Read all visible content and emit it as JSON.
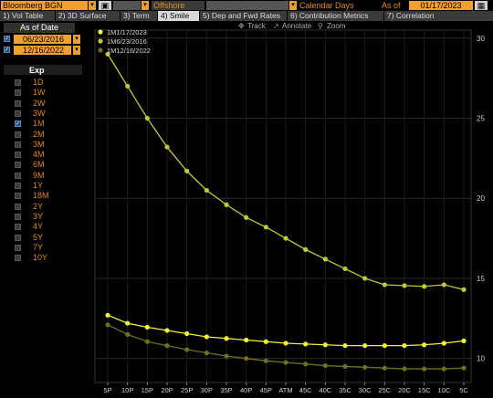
{
  "topbar": {
    "source": "Bloomberg BGN",
    "field2": "",
    "field3": "",
    "location": "Offshore",
    "field5": "",
    "days_mode": "Calendar Days",
    "asof_label": "As of",
    "asof_date": "01/17/2023"
  },
  "tabs": [
    {
      "label": "1) Vol Table"
    },
    {
      "label": "2) 3D Surface"
    },
    {
      "label": "3) Term"
    },
    {
      "label": "4) Smile"
    },
    {
      "label": "5) Dep and Fwd Rates"
    },
    {
      "label": "6) Contribution Metrics"
    },
    {
      "label": "7) Correlation"
    }
  ],
  "sidebar": {
    "header": "As of Date",
    "dates": [
      "06/23/2016",
      "12/16/2022"
    ],
    "exp_header": "Exp",
    "expiries": [
      "1D",
      "1W",
      "2W",
      "3W",
      "1M",
      "2M",
      "3M",
      "4M",
      "6M",
      "9M",
      "1Y",
      "18M",
      "2Y",
      "3Y",
      "4Y",
      "5Y",
      "7Y",
      "10Y"
    ],
    "checked_expiry": "1M"
  },
  "toolbar": {
    "track": "Track",
    "annotate": "Annotate",
    "zoom": "Zoom"
  },
  "chart_data": {
    "type": "line",
    "categories": [
      "5P",
      "10P",
      "15P",
      "20P",
      "25P",
      "30P",
      "35P",
      "40P",
      "45P",
      "ATM",
      "45C",
      "40C",
      "35C",
      "30C",
      "25C",
      "20C",
      "15C",
      "10C",
      "5C"
    ],
    "ylim": [
      8.5,
      30.5
    ],
    "yticks": [
      10,
      15,
      20,
      25,
      30
    ],
    "legend_position": "top-left",
    "series": [
      {
        "name": "1M1/17/2023",
        "color": "#f2f23a",
        "values": [
          12.7,
          12.2,
          11.95,
          11.75,
          11.55,
          11.35,
          11.25,
          11.15,
          11.05,
          10.95,
          10.9,
          10.85,
          10.8,
          10.8,
          10.8,
          10.8,
          10.85,
          10.95,
          11.1
        ]
      },
      {
        "name": "1M6/23/2016",
        "color": "#c2c83a",
        "values": [
          29.0,
          27.0,
          25.0,
          23.2,
          21.7,
          20.5,
          19.6,
          18.8,
          18.2,
          17.5,
          16.8,
          16.2,
          15.6,
          15.0,
          14.6,
          14.55,
          14.5,
          14.6,
          14.3
        ]
      },
      {
        "name": "1M12/16/2022",
        "color": "#6f6f22",
        "values": [
          12.1,
          11.5,
          11.05,
          10.8,
          10.55,
          10.35,
          10.15,
          10.0,
          9.85,
          9.75,
          9.65,
          9.55,
          9.5,
          9.45,
          9.4,
          9.35,
          9.35,
          9.35,
          9.4
        ]
      }
    ]
  }
}
